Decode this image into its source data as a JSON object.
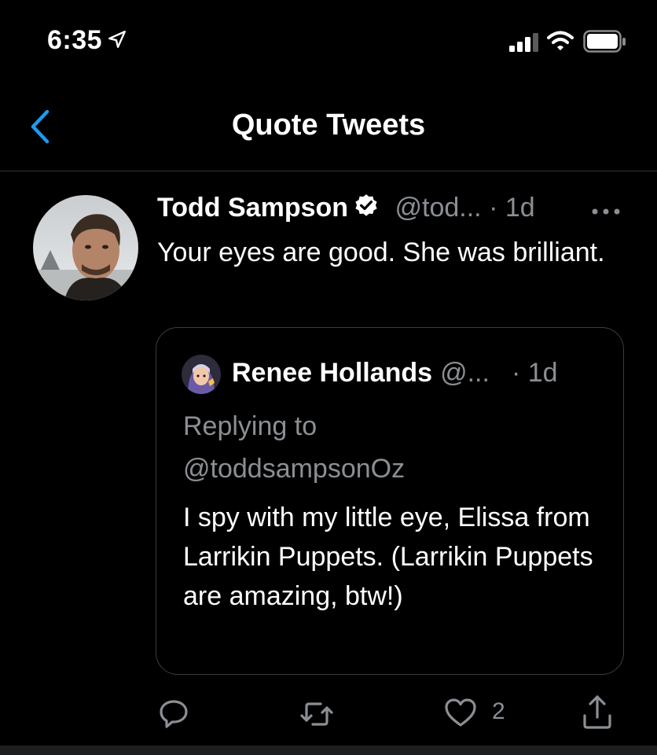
{
  "status_bar": {
    "time": "6:35",
    "icons": [
      "location-arrow-icon",
      "signal-bars-icon",
      "wifi-icon",
      "battery-icon"
    ]
  },
  "nav": {
    "title": "Quote Tweets",
    "back_icon": "chevron-left-icon"
  },
  "tweet": {
    "author_name": "Todd Sampson",
    "verified": true,
    "handle": "@tod...",
    "dot": "·",
    "time": "1d",
    "text": "Your eyes are good. She was brilliant.",
    "quoted": {
      "author_name": "Renee Hollands",
      "handle": "@...",
      "time": "· 1d",
      "replying_to_label": "Replying to",
      "replying_to_handle": "@toddsampsonOz",
      "text": "I spy with my little eye, Elissa from Larrikin Puppets. (Larrikin Puppets are amazing, btw!)"
    },
    "actions": {
      "reply_icon": "reply-bubble-icon",
      "retweet_icon": "retweet-icon",
      "like_icon": "heart-icon",
      "like_count": "2",
      "share_icon": "share-icon"
    }
  },
  "colors": {
    "background": "#000000",
    "text_primary": "#ffffff",
    "text_secondary": "#8b8f94",
    "accent": "#1d9bf0",
    "divider": "#2f3336"
  }
}
